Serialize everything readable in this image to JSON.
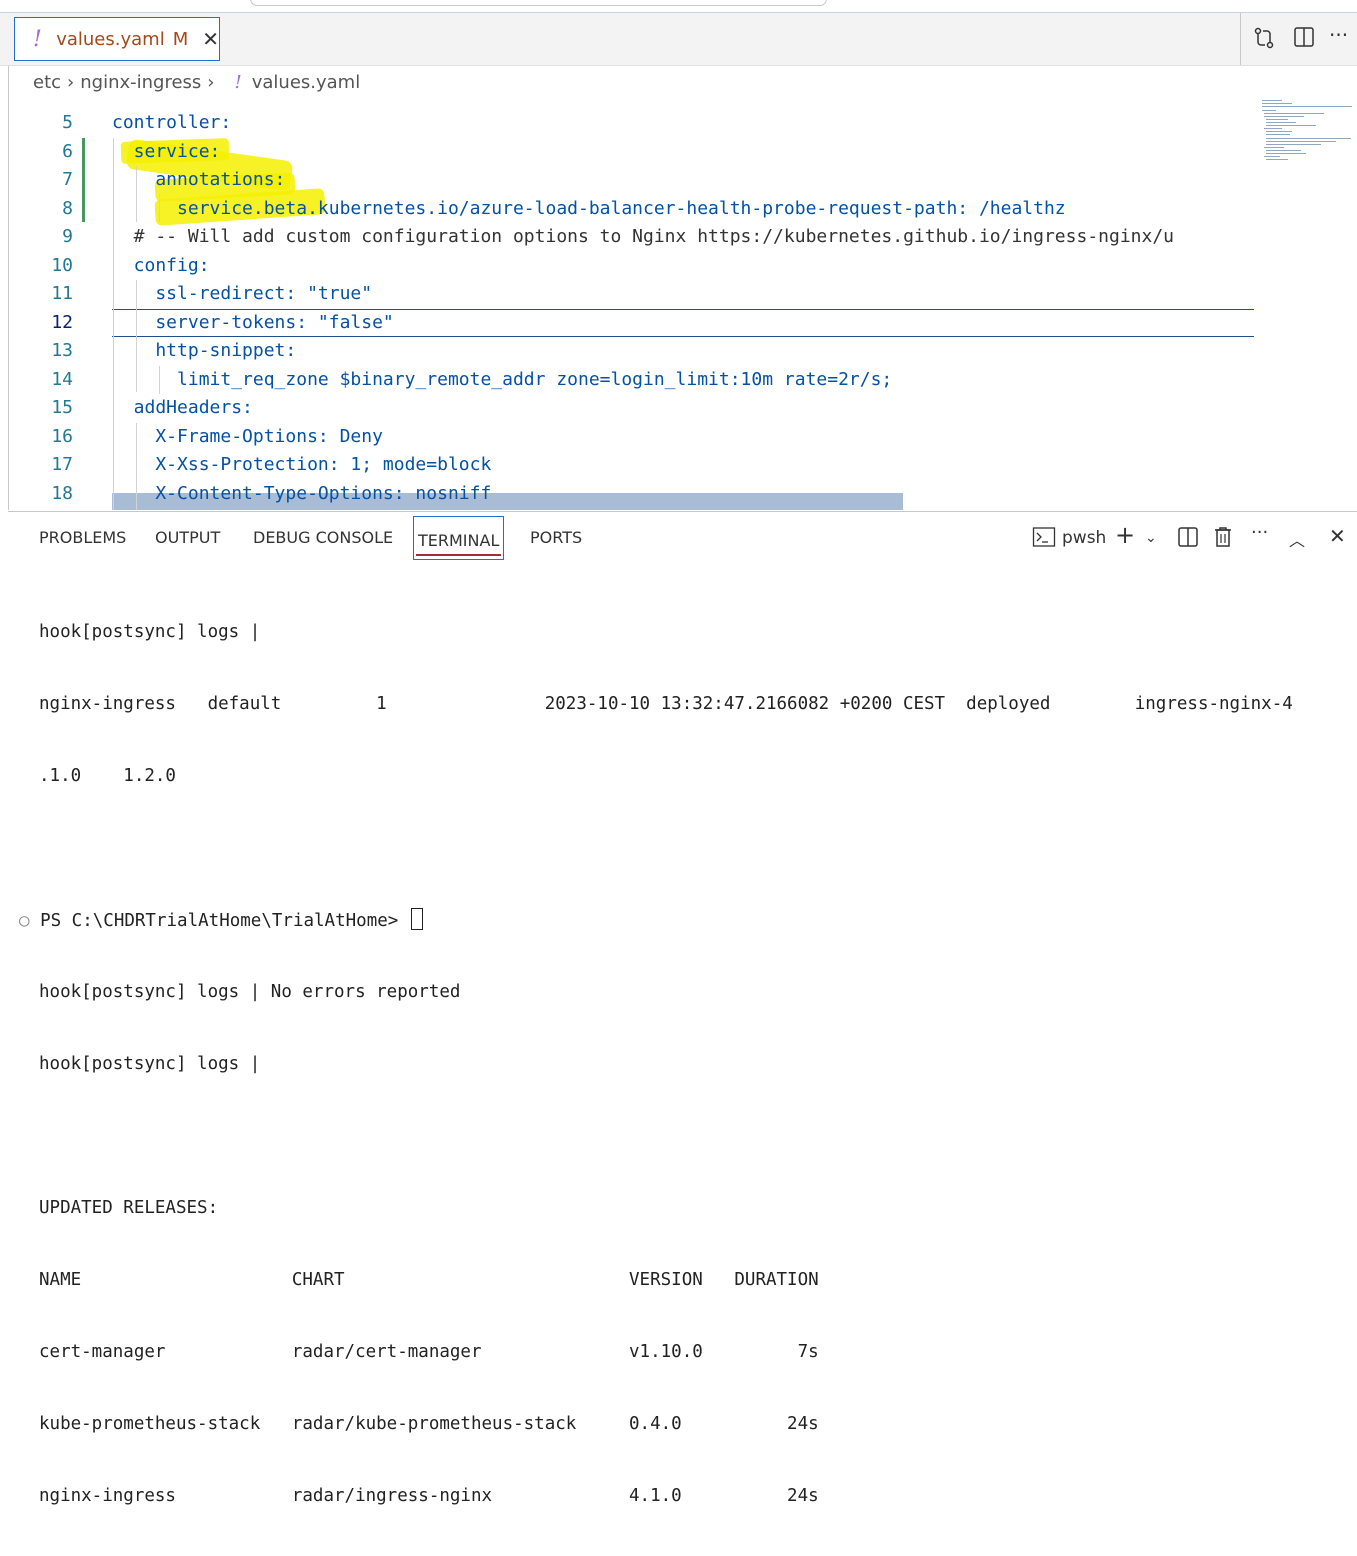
{
  "tab": {
    "icon": "!",
    "filename": "values.yaml",
    "modified": "M",
    "close": "✕"
  },
  "tab_actions": {
    "compare": "compare-changes-icon",
    "split": "split-editor-icon",
    "more": "···"
  },
  "breadcrumb": [
    "etc",
    "nginx-ingress",
    "values.yaml"
  ],
  "editor": {
    "partial_top_line": "4",
    "lines": [
      {
        "n": "5",
        "text": "controller:"
      },
      {
        "n": "6",
        "text": "  service:"
      },
      {
        "n": "7",
        "text": "    annotations:"
      },
      {
        "n": "8",
        "text": "      service.beta.kubernetes.io/azure-load-balancer-health-probe-request-path: /healthz"
      },
      {
        "n": "9",
        "text": "  # -- Will add custom configuration options to Nginx https://kubernetes.github.io/ingress-nginx/u"
      },
      {
        "n": "10",
        "text": "  config:"
      },
      {
        "n": "11",
        "text": "    ssl-redirect: \"true\""
      },
      {
        "n": "12",
        "text": "    server-tokens: \"false\""
      },
      {
        "n": "13",
        "text": "    http-snippet:"
      },
      {
        "n": "14",
        "text": "      limit_req_zone $binary_remote_addr zone=login_limit:10m rate=2r/s;"
      },
      {
        "n": "15",
        "text": "  addHeaders:"
      },
      {
        "n": "16",
        "text": "    X-Frame-Options: Deny"
      },
      {
        "n": "17",
        "text": "    X-Xss-Protection: 1; mode=block"
      },
      {
        "n": "18",
        "text": "    X-Content-Type-Options: nosniff"
      }
    ]
  },
  "panel": {
    "tabs": [
      "PROBLEMS",
      "OUTPUT",
      "DEBUG CONSOLE",
      "TERMINAL",
      "PORTS"
    ],
    "active_tab": "TERMINAL",
    "shell": "pwsh",
    "terminal_lines": [
      "hook[postsync] logs |",
      "nginx-ingress   default         1               2023-10-10 13:32:47.2166082 +0200 CEST  deployed        ingress-nginx-4",
      ".1.0    1.2.0",
      "",
      "",
      "hook[postsync] logs | No errors reported",
      "hook[postsync] logs |",
      "",
      "UPDATED RELEASES:",
      "NAME                    CHART                           VERSION   DURATION",
      "cert-manager            radar/cert-manager              v1.10.0         7s",
      "kube-prometheus-stack   radar/kube-prometheus-stack     0.4.0          24s",
      "nginx-ingress           radar/ingress-nginx             4.1.0          24s"
    ],
    "prompt": "PS C:\\CHDRTrialAtHome\\TrialAtHome>"
  }
}
